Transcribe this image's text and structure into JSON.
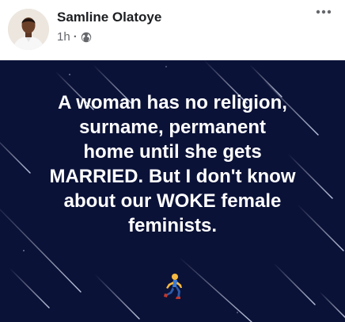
{
  "post": {
    "author": "Samline Olatoye",
    "time": "1h",
    "separator": "·",
    "privacy_icon": "globe-icon",
    "menu_icon": "more-options-icon",
    "message": "A woman has no religion,\nsurname, permanent\nhome until she gets\nMARRIED. But I don't know\nabout our WOKE female\nfeminists.",
    "emoji_icon": "person-running-icon"
  },
  "colors": {
    "background": "#ffffff",
    "image_background": "#0b1238",
    "author_text": "#1c1e21",
    "meta_text": "#65676b",
    "message_text": "#ffffff"
  }
}
